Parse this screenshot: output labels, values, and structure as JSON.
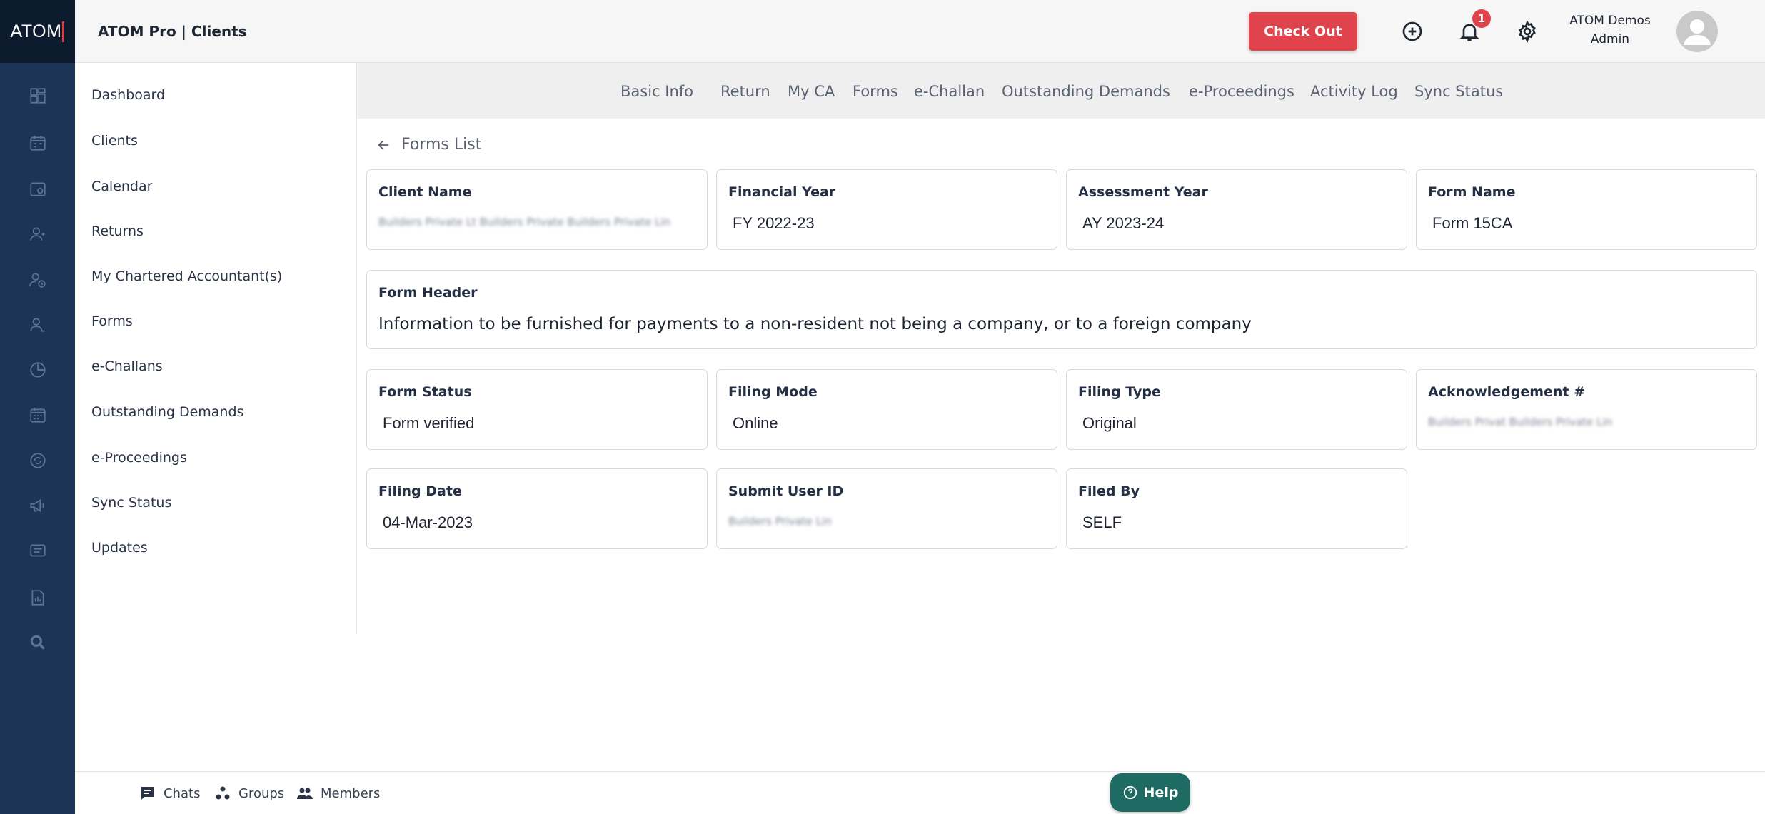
{
  "brand": {
    "logo_main": "ATO",
    "logo_last": "M"
  },
  "topbar": {
    "title": "ATOM Pro | Clients",
    "checkout_label": "Check Out",
    "notification_count": "1",
    "user_name": "ATOM Demos",
    "user_role": "Admin"
  },
  "icons": {
    "rail": [
      "dashboard-icon",
      "calendar-icon",
      "clients-icon",
      "user-icon",
      "returns-icon",
      "member-icon",
      "pie-chart-icon",
      "calendar-grid-icon",
      "refresh-icon",
      "megaphone-icon",
      "chat-icon",
      "report-icon",
      "search-icon"
    ],
    "top": [
      "add-circle-icon",
      "bell-icon",
      "gear-icon",
      "avatar-icon"
    ]
  },
  "sidebar": {
    "items": [
      {
        "label": "Dashboard"
      },
      {
        "label": "Clients"
      },
      {
        "label": "Calendar"
      },
      {
        "label": "Returns"
      },
      {
        "label": "My Chartered Accountant(s)"
      },
      {
        "label": "Forms"
      },
      {
        "label": "e-Challans"
      },
      {
        "label": "Outstanding Demands"
      },
      {
        "label": "e-Proceedings"
      },
      {
        "label": "Sync Status"
      },
      {
        "label": "Updates"
      }
    ]
  },
  "tabs": [
    {
      "label": "Basic Info"
    },
    {
      "label": "Return"
    },
    {
      "label": "My CA"
    },
    {
      "label": "Forms"
    },
    {
      "label": "e-Challan"
    },
    {
      "label": "Outstanding Demands"
    },
    {
      "label": "e-Proceedings"
    },
    {
      "label": "Activity Log"
    },
    {
      "label": "Sync Status"
    }
  ],
  "back_label": "Forms List",
  "form": {
    "client_name": {
      "label": "Client Name",
      "value": "Builders Private Lt Builders Private Builders Private Lin"
    },
    "financial_year": {
      "label": "Financial Year",
      "value": "FY 2022-23"
    },
    "assessment_year": {
      "label": "Assessment Year",
      "value": "AY 2023-24"
    },
    "form_name": {
      "label": "Form Name",
      "value": "Form 15CA"
    },
    "form_header": {
      "label": "Form Header",
      "value": "Information to be furnished for payments to a non-resident not being a company, or to a foreign company"
    },
    "form_status": {
      "label": "Form Status",
      "value": "Form verified"
    },
    "filing_mode": {
      "label": "Filing Mode",
      "value": "Online"
    },
    "filing_type": {
      "label": "Filing Type",
      "value": "Original"
    },
    "acknowledgement": {
      "label": "Acknowledgement #",
      "value": "Builders Privat Builders Private Lin"
    },
    "filing_date": {
      "label": "Filing Date",
      "value": "04-Mar-2023"
    },
    "submit_user_id": {
      "label": "Submit User ID",
      "value": "Builders Private Lin"
    },
    "filed_by": {
      "label": "Filed By",
      "value": "SELF"
    }
  },
  "bottombar": {
    "chats": "Chats",
    "groups": "Groups",
    "members": "Members",
    "help": "Help"
  },
  "colors": {
    "rail": "#1c3557",
    "logo_bg": "#0d1b2e",
    "checkout": "#e0434b",
    "help": "#1d6b62"
  }
}
